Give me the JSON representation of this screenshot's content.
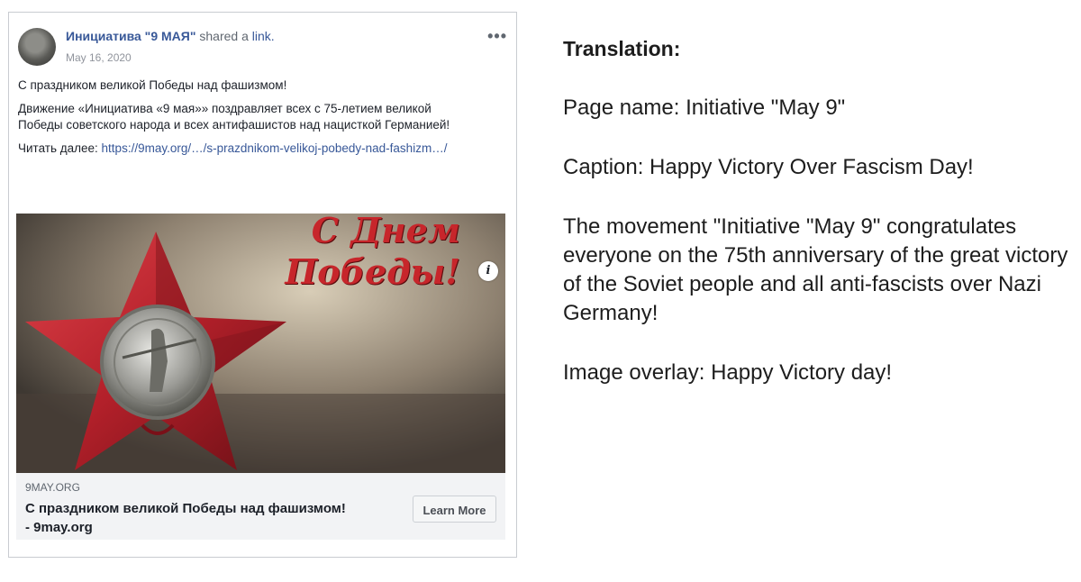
{
  "post": {
    "page_name": "Инициатива \"9 МАЯ\"",
    "shared_text": "shared a",
    "link_word": "link.",
    "date": "May 16, 2020",
    "more_label": "•••",
    "caption_title": "С праздником великой Победы над фашизмом!",
    "caption_body": "Движение «Инициатива «9 мая»» поздравляет всех с 75-летием великой Победы советского народа и всех антифашистов над нацисткой Германией!",
    "read_more_label": "Читать далее:",
    "read_more_url": "https://9may.org/…/s-prazdnikom-velikoj-pobedy-nad-fashizm…/",
    "image_overlay_line1": "С Днем",
    "image_overlay_line2": "Победы!",
    "info_label": "i",
    "link_domain": "9MAY.ORG",
    "link_title": "С праздником великой Победы над фашизмом! - 9may.org",
    "learn_more_label": "Learn More"
  },
  "translation": {
    "title": "Translation:",
    "page_name": "Page name: Initiative \"May 9\"",
    "caption": "Caption: Happy Victory Over Fascism Day!",
    "body": "The movement \"Initiative \"May 9\" congratulates everyone on the 75th anniversary of the great victory of the Soviet people and all anti-fascists over Nazi Germany!",
    "overlay": "Image overlay: Happy Victory day!"
  },
  "colors": {
    "link_blue": "#385898",
    "overlay_red": "#c7262b",
    "star_red": "#b3202a"
  },
  "icons": {
    "more": "more-options-icon",
    "info": "info-icon",
    "star": "red-star-medal-icon"
  }
}
